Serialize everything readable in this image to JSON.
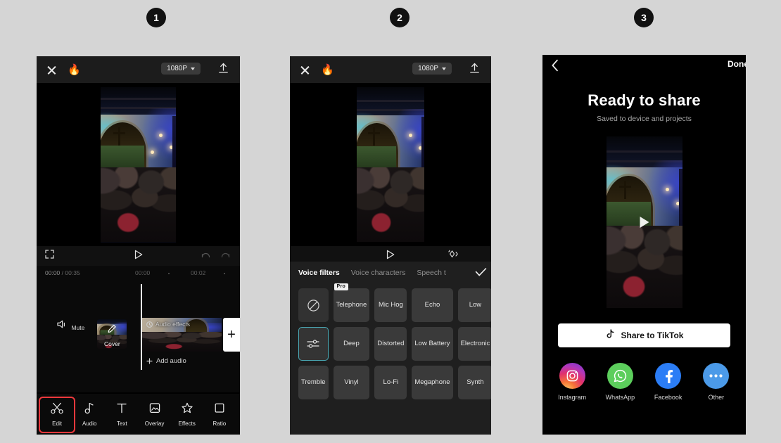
{
  "background_color": "#d5d5d5",
  "steps": [
    {
      "number": "1"
    },
    {
      "number": "2"
    },
    {
      "number": "3"
    }
  ],
  "panel1": {
    "top_bar": {
      "close_icon": "close-x-icon",
      "flame_icon": "flame-icon",
      "resolution": "1080P",
      "export_icon": "export-upload-icon"
    },
    "preview": {
      "scene": "church-interior-video"
    },
    "controls": {
      "expand_icon": "expand-fullscreen-icon",
      "play_icon": "play-icon",
      "undo_icon": "undo-icon",
      "redo_icon": "redo-icon"
    },
    "timeline": {
      "current_time": "00:00",
      "separator": "/",
      "total_time": "00:35",
      "ruler_marks": [
        "00:00",
        "00:02"
      ],
      "mute_label": "Mute",
      "cover_label": "Cover",
      "clip_effect_label": "Audio effects",
      "add_audio_label": "Add audio",
      "add_clip_label": "+"
    },
    "toolbar": [
      {
        "label": "Edit",
        "icon": "scissors-icon",
        "highlighted": true
      },
      {
        "label": "Audio",
        "icon": "music-note-icon",
        "highlighted": false
      },
      {
        "label": "Text",
        "icon": "text-t-icon",
        "highlighted": false
      },
      {
        "label": "Overlay",
        "icon": "overlay-frame-icon",
        "highlighted": false
      },
      {
        "label": "Effects",
        "icon": "sparkle-star-icon",
        "highlighted": false
      },
      {
        "label": "Ratio",
        "icon": "square-ratio-icon",
        "highlighted": false
      }
    ],
    "highlight_color": "#f0383c"
  },
  "panel2": {
    "top_bar": {
      "close_icon": "close-x-icon",
      "flame_icon": "flame-icon",
      "resolution": "1080P",
      "export_icon": "export-upload-icon"
    },
    "controls": {
      "play_icon": "play-icon",
      "sparkle_icon": "sparkle-diamond-icon"
    },
    "sheet": {
      "tabs": [
        {
          "label": "Voice filters",
          "active": true
        },
        {
          "label": "Voice characters",
          "active": false
        },
        {
          "label": "Speech t",
          "active": false
        }
      ],
      "confirm_icon": "checkmark-icon",
      "filters": [
        {
          "label": "",
          "icon": "none-prohibited-icon",
          "selected": false,
          "pro": false
        },
        {
          "label": "Telephone",
          "icon": "",
          "selected": false,
          "pro": true,
          "pro_label": "Pro"
        },
        {
          "label": "Mic Hog",
          "icon": "",
          "selected": false,
          "pro": false
        },
        {
          "label": "Echo",
          "icon": "",
          "selected": false,
          "pro": false
        },
        {
          "label": "Low",
          "icon": "",
          "selected": false,
          "pro": false
        },
        {
          "label": "",
          "icon": "sliders-adjust-icon",
          "selected": true,
          "pro": false
        },
        {
          "label": "Deep",
          "icon": "",
          "selected": false,
          "pro": false
        },
        {
          "label": "Distorted",
          "icon": "",
          "selected": false,
          "pro": false
        },
        {
          "label": "Low Battery",
          "icon": "",
          "selected": false,
          "pro": false
        },
        {
          "label": "Electronic",
          "icon": "",
          "selected": false,
          "pro": false
        },
        {
          "label": "Tremble",
          "icon": "",
          "selected": false,
          "pro": false
        },
        {
          "label": "Vinyl",
          "icon": "",
          "selected": false,
          "pro": false
        },
        {
          "label": "Lo-Fi",
          "icon": "",
          "selected": false,
          "pro": false
        },
        {
          "label": "Megaphone",
          "icon": "",
          "selected": false,
          "pro": false
        },
        {
          "label": "Synth",
          "icon": "",
          "selected": false,
          "pro": false
        }
      ],
      "selected_accent": "#4aa9b5"
    }
  },
  "panel3": {
    "back_icon": "chevron-left-icon",
    "done_label": "Done",
    "title": "Ready to share",
    "subtitle": "Saved to device and projects",
    "video_play_icon": "play-icon",
    "tiktok_button": {
      "label": "Share to TikTok",
      "icon": "tiktok-note-icon"
    },
    "share_targets": [
      {
        "label": "Instagram",
        "icon": "instagram-icon",
        "color": "#e1306c"
      },
      {
        "label": "WhatsApp",
        "icon": "whatsapp-icon",
        "color": "#5cce5c"
      },
      {
        "label": "Facebook",
        "icon": "facebook-icon",
        "color": "#2b7df6"
      },
      {
        "label": "Other",
        "icon": "more-dots-icon",
        "color": "#4b9ae8"
      }
    ]
  }
}
